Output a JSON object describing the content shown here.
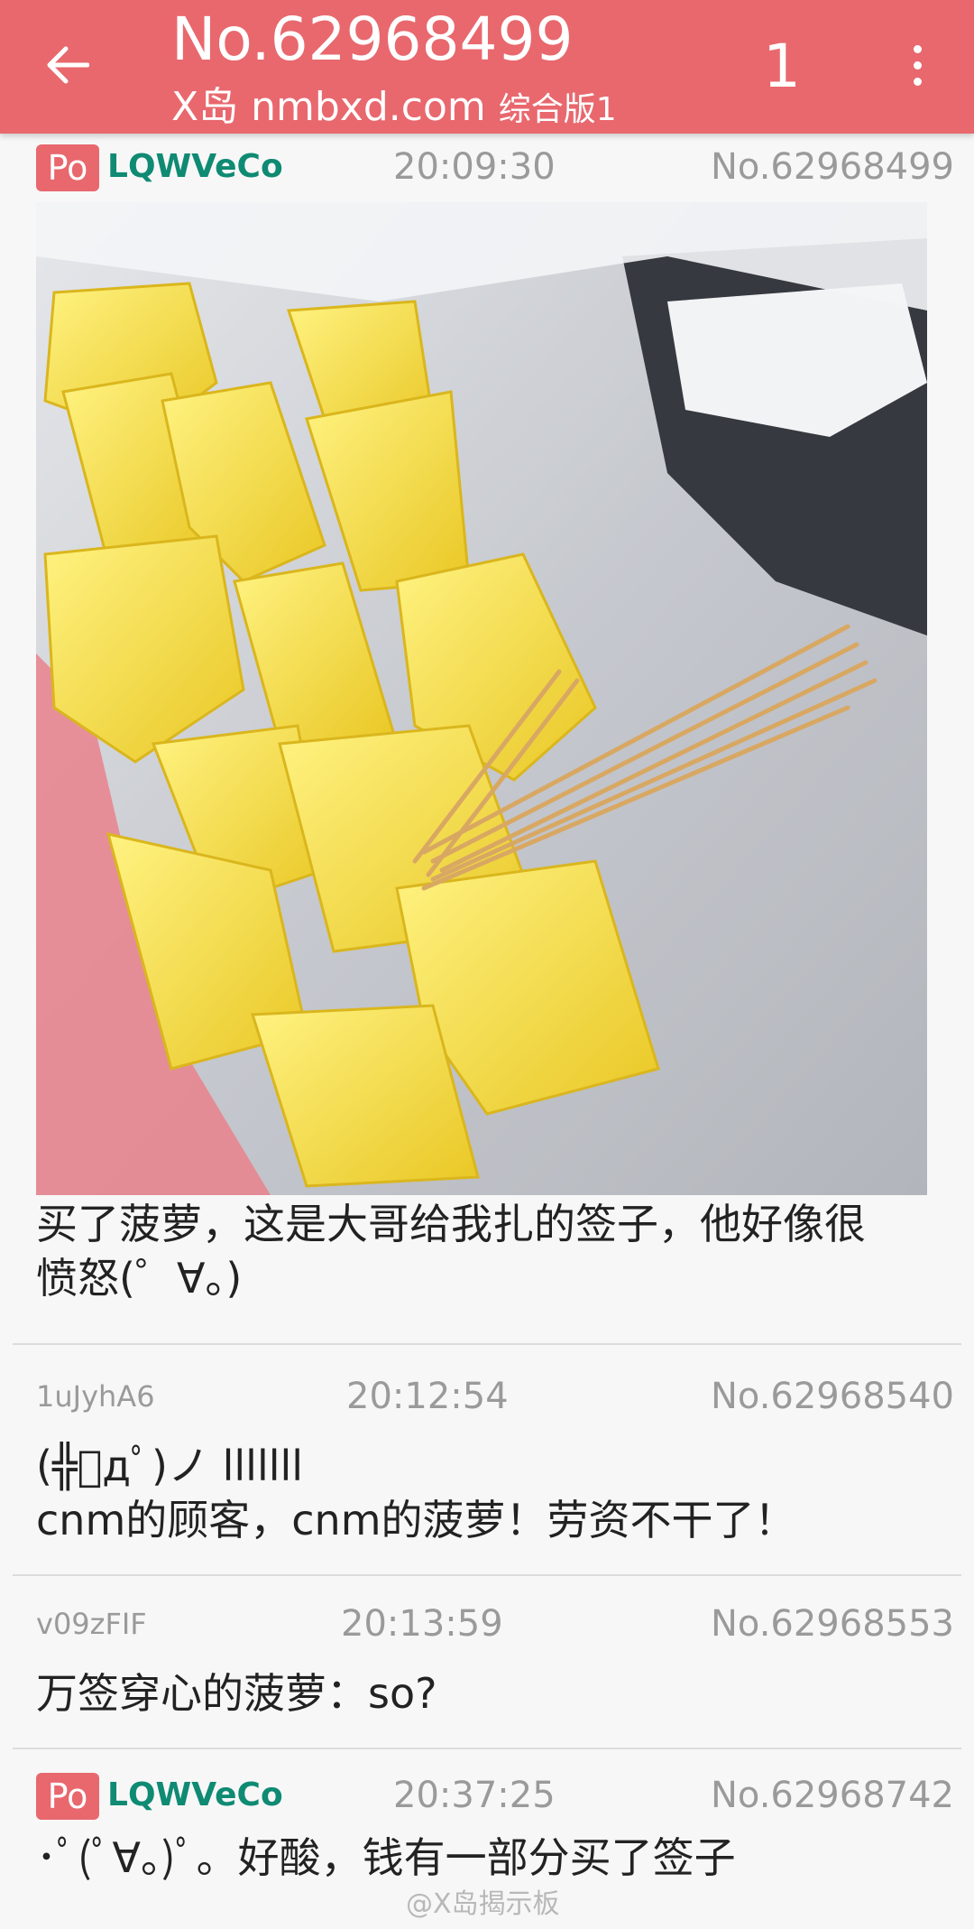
{
  "appbar": {
    "title": "No.62968499",
    "subtitle_site": "X岛 nmbxd.com",
    "subtitle_board": "综合版1",
    "page_count": "1"
  },
  "posts": [
    {
      "po_badge": "Po",
      "user_id": "LQWVeCo",
      "time": "20:09:30",
      "number": "No.62968499",
      "content": "买了菠萝，这是大哥给我扎的签子，他好像很\n愤怒(゜∀。)"
    },
    {
      "user_id": "1uJyhA6",
      "time": "20:12:54",
      "number": "No.62968540",
      "content": "(╬ﾟдﾟ)ノ lllllll\ncnm的顾客，cnm的菠萝！劳资不干了！"
    },
    {
      "user_id": "v09zFIF",
      "time": "20:13:59",
      "number": "No.62968553",
      "content": "万签穿心的菠萝：so?"
    },
    {
      "po_badge": "Po",
      "user_id": "LQWVeCo",
      "time": "20:37:25",
      "number": "No.62968742",
      "content": "･ﾟ(ﾟ∀。)ﾟ。好酸，钱有一部分买了签子"
    }
  ],
  "watermark": "@X岛揭示板",
  "icons": [
    "back-arrow-icon",
    "more-vert-icon"
  ],
  "colors": {
    "accent": "#e8686e",
    "po_uid": "#0f8a73"
  }
}
